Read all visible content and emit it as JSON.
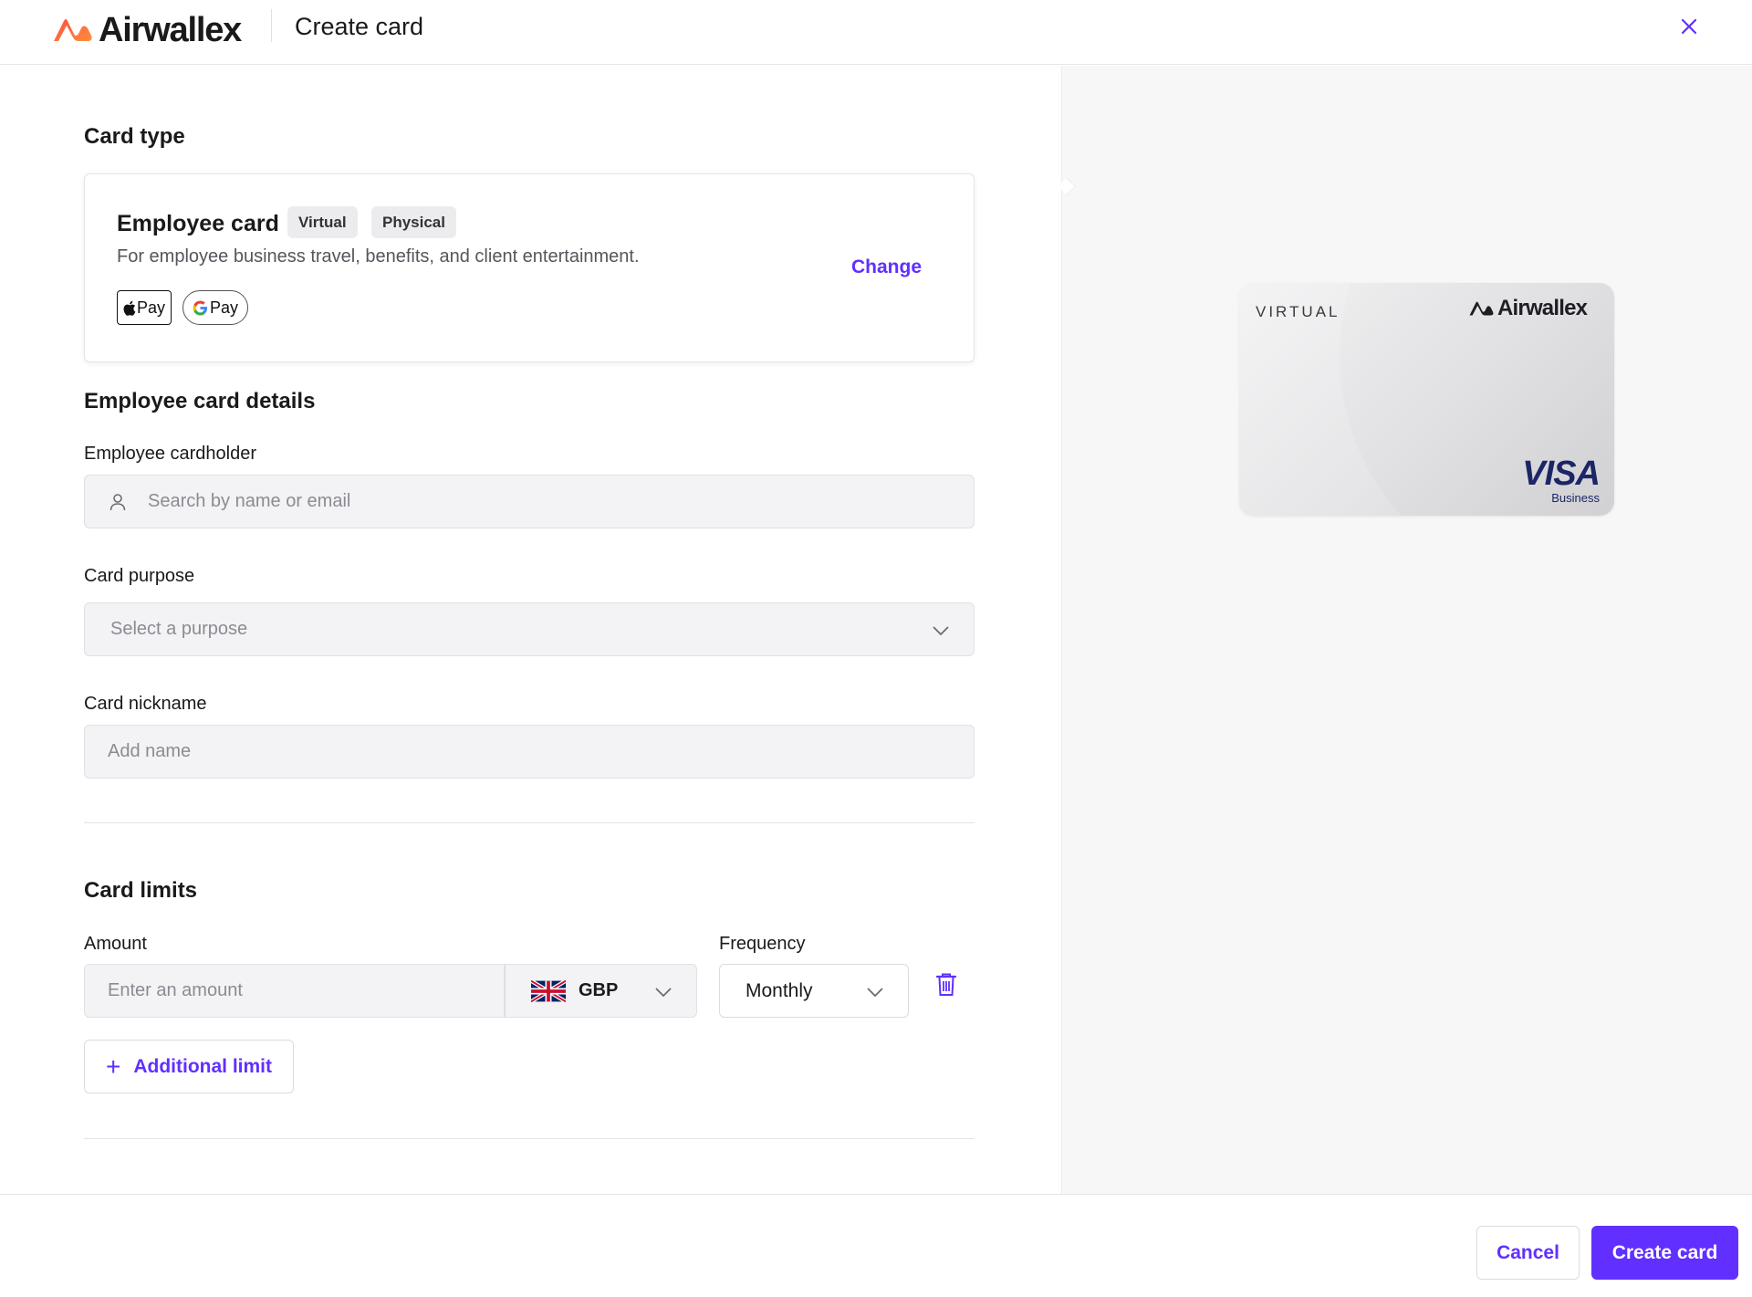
{
  "header": {
    "brand_name": "Airwallex",
    "title": "Create card"
  },
  "card_type": {
    "section_title": "Card type",
    "name": "Employee card",
    "badges": [
      "Virtual",
      "Physical"
    ],
    "description": "For employee business travel, benefits, and client entertainment.",
    "change_label": "Change",
    "wallets": [
      "Apple Pay",
      "Google Pay"
    ],
    "apple_pay_label": "Pay",
    "google_pay_label": "Pay"
  },
  "details": {
    "section_title": "Employee card details",
    "cardholder_label": "Employee cardholder",
    "cardholder_placeholder": "Search by name or email",
    "purpose_label": "Card purpose",
    "purpose_placeholder": "Select a purpose",
    "nickname_label": "Card nickname",
    "nickname_placeholder": "Add name"
  },
  "limits": {
    "section_title": "Card limits",
    "amount_label": "Amount",
    "amount_placeholder": "Enter an amount",
    "currency": "GBP",
    "frequency_label": "Frequency",
    "frequency": "Monthly",
    "add_limit_label": "Additional limit"
  },
  "card_preview": {
    "type_label": "VIRTUAL",
    "brand_name": "Airwallex",
    "network": "VISA",
    "network_sub": "Business"
  },
  "footer": {
    "cancel_label": "Cancel",
    "create_label": "Create card"
  },
  "colors": {
    "accent": "#612fff",
    "brand_orange": "#ff6b3d",
    "visa_blue": "#1c2566"
  }
}
